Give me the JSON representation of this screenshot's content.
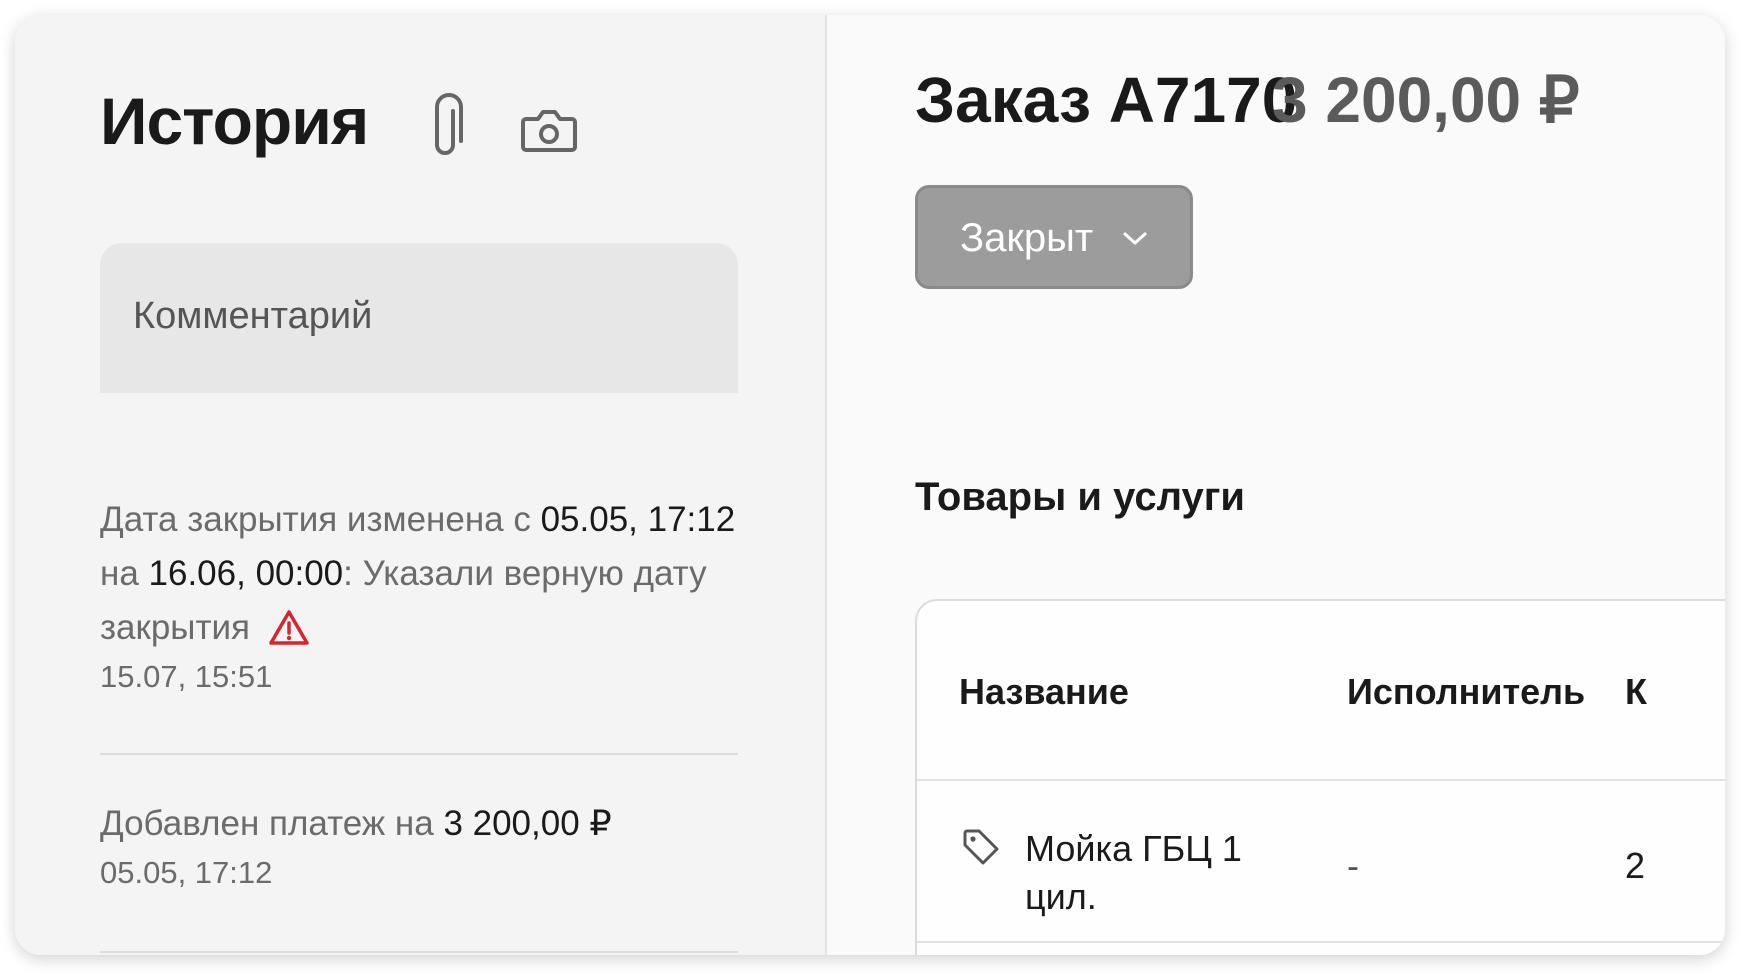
{
  "history": {
    "title": "История",
    "attach_icon": "paperclip-icon",
    "camera_icon": "camera-icon",
    "comment_placeholder": "Комментарий",
    "entries": [
      {
        "text_1": "Дата закрытия изменена с ",
        "value_1": "05.05, 17:12",
        "text_2": "на ",
        "value_2": "16.06, 00:00",
        "text_3": ": Указали верную дату",
        "text_4": "закрытия",
        "warning_icon": "warning-icon",
        "timestamp": "15.07, 15:51"
      },
      {
        "text_1": "Добавлен платеж на ",
        "value_1": "3 200,00 ₽",
        "timestamp": "05.05, 17:12"
      }
    ]
  },
  "order": {
    "title": "Заказ A7170",
    "amount": "3 200,00 ₽",
    "status": "Закрыт",
    "status_icon": "chevron-down-icon",
    "section_title": "Товары и услуги",
    "table": {
      "columns": [
        "Название",
        "Исполнитель",
        "К"
      ],
      "rows": [
        {
          "icon": "tag-icon",
          "name_line1": "Мойка ГБЦ 1",
          "name_line2": "цил.",
          "performer": "-",
          "qty": "2"
        }
      ]
    }
  },
  "colors": {
    "warning": "#d9232e",
    "status_button": "#9c9c9c",
    "amount": "#5b5b5b"
  }
}
